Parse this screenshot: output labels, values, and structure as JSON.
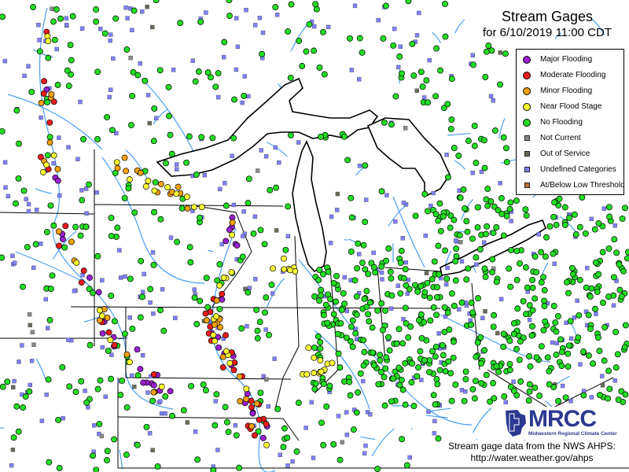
{
  "title": "Stream Gages",
  "subtitle": "for 6/10/2019 11:00 CDT",
  "legend": [
    {
      "label": "Major Flooding",
      "shape": "circle",
      "color": "#9b1fd1"
    },
    {
      "label": "Moderate Flooding",
      "shape": "circle",
      "color": "#ee1c1c"
    },
    {
      "label": "Minor Flooding",
      "shape": "circle",
      "color": "#f5a20a"
    },
    {
      "label": "Near Flood Stage",
      "shape": "circle",
      "color": "#ffff33"
    },
    {
      "label": "No Flooding",
      "shape": "circle",
      "color": "#22dd22"
    },
    {
      "label": "Not Current",
      "shape": "square",
      "color": "#8a8a8a"
    },
    {
      "label": "Out of Service",
      "shape": "square",
      "color": "#6b6b5a"
    },
    {
      "label": "Undefined Categories",
      "shape": "square",
      "color": "#8080ff"
    },
    {
      "label": "At/Below Low Threshold",
      "shape": "square",
      "color": "#b87333"
    }
  ],
  "logo": {
    "name": "MRCC",
    "subtitle": "Midwestern Regional Climate Center"
  },
  "credit": {
    "line1": "Stream gage data from the NWS AHPS:",
    "line2": "http://water.weather.gov/ahps"
  },
  "colors": {
    "water_line": "#4a9ff5",
    "state_border": "#000000",
    "lake_fill": "#ffffff"
  }
}
